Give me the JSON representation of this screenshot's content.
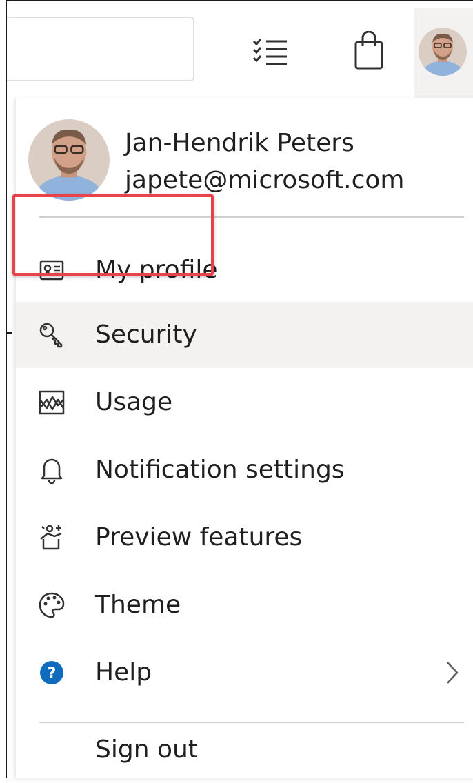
{
  "topbar": {
    "icons": [
      "tasks-list-icon",
      "shopping-bag-icon",
      "avatar"
    ]
  },
  "profile": {
    "name": "Jan-Hendrik Peters",
    "email": "japete@microsoft.com"
  },
  "menu": {
    "items": [
      {
        "label": "My profile",
        "icon": "contact-card-icon"
      },
      {
        "label": "Security",
        "icon": "key-icon",
        "highlighted": true
      },
      {
        "label": "Usage",
        "icon": "usage-chart-icon"
      },
      {
        "label": "Notification settings",
        "icon": "bell-icon"
      },
      {
        "label": "Preview features",
        "icon": "preview-gift-icon"
      },
      {
        "label": "Theme",
        "icon": "palette-icon"
      },
      {
        "label": "Help",
        "icon": "help-circle-icon",
        "has_submenu": true
      }
    ],
    "sign_out": "Sign out"
  },
  "colors": {
    "highlight_border": "#e8434a",
    "hover_bg": "#f3f2f1",
    "help_blue": "#0f6cbd",
    "text": "#201f1e"
  }
}
